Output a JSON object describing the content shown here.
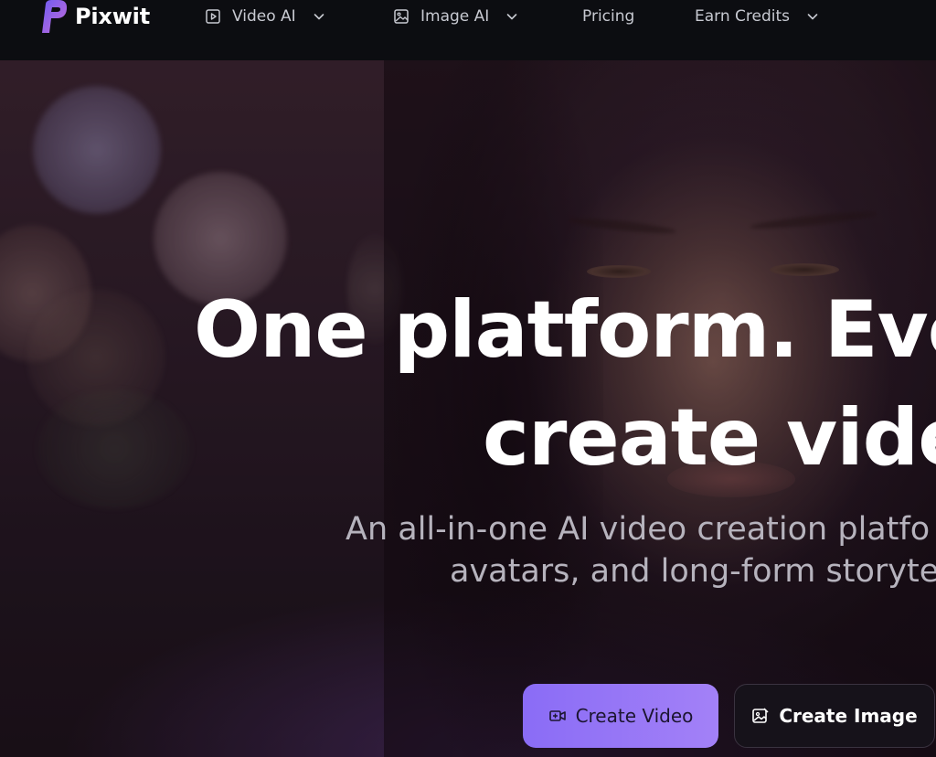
{
  "brand": {
    "name": "Pixwit",
    "accent": "#8b6cf6",
    "logo_gradient": [
      "#6f5cf2",
      "#c46bd9"
    ]
  },
  "nav": {
    "items": [
      {
        "label": "Video AI",
        "icon": "play-square-icon",
        "has_dropdown": true
      },
      {
        "label": "Image AI",
        "icon": "image-icon",
        "has_dropdown": true
      },
      {
        "label": "Pricing",
        "icon": null,
        "has_dropdown": false
      },
      {
        "label": "Earn Credits",
        "icon": null,
        "has_dropdown": true
      }
    ]
  },
  "hero": {
    "headline_line1": "One platform. Ever",
    "headline_line2": "create vide",
    "subtitle_line1": "An all-in-one AI video creation platfo",
    "subtitle_line2": "avatars, and long-form storyte",
    "buttons": [
      {
        "label": "Create Video",
        "icon": "video-camera-icon",
        "style": "primary"
      },
      {
        "label": "Create Image",
        "icon": "image-edit-icon",
        "style": "secondary"
      }
    ]
  }
}
